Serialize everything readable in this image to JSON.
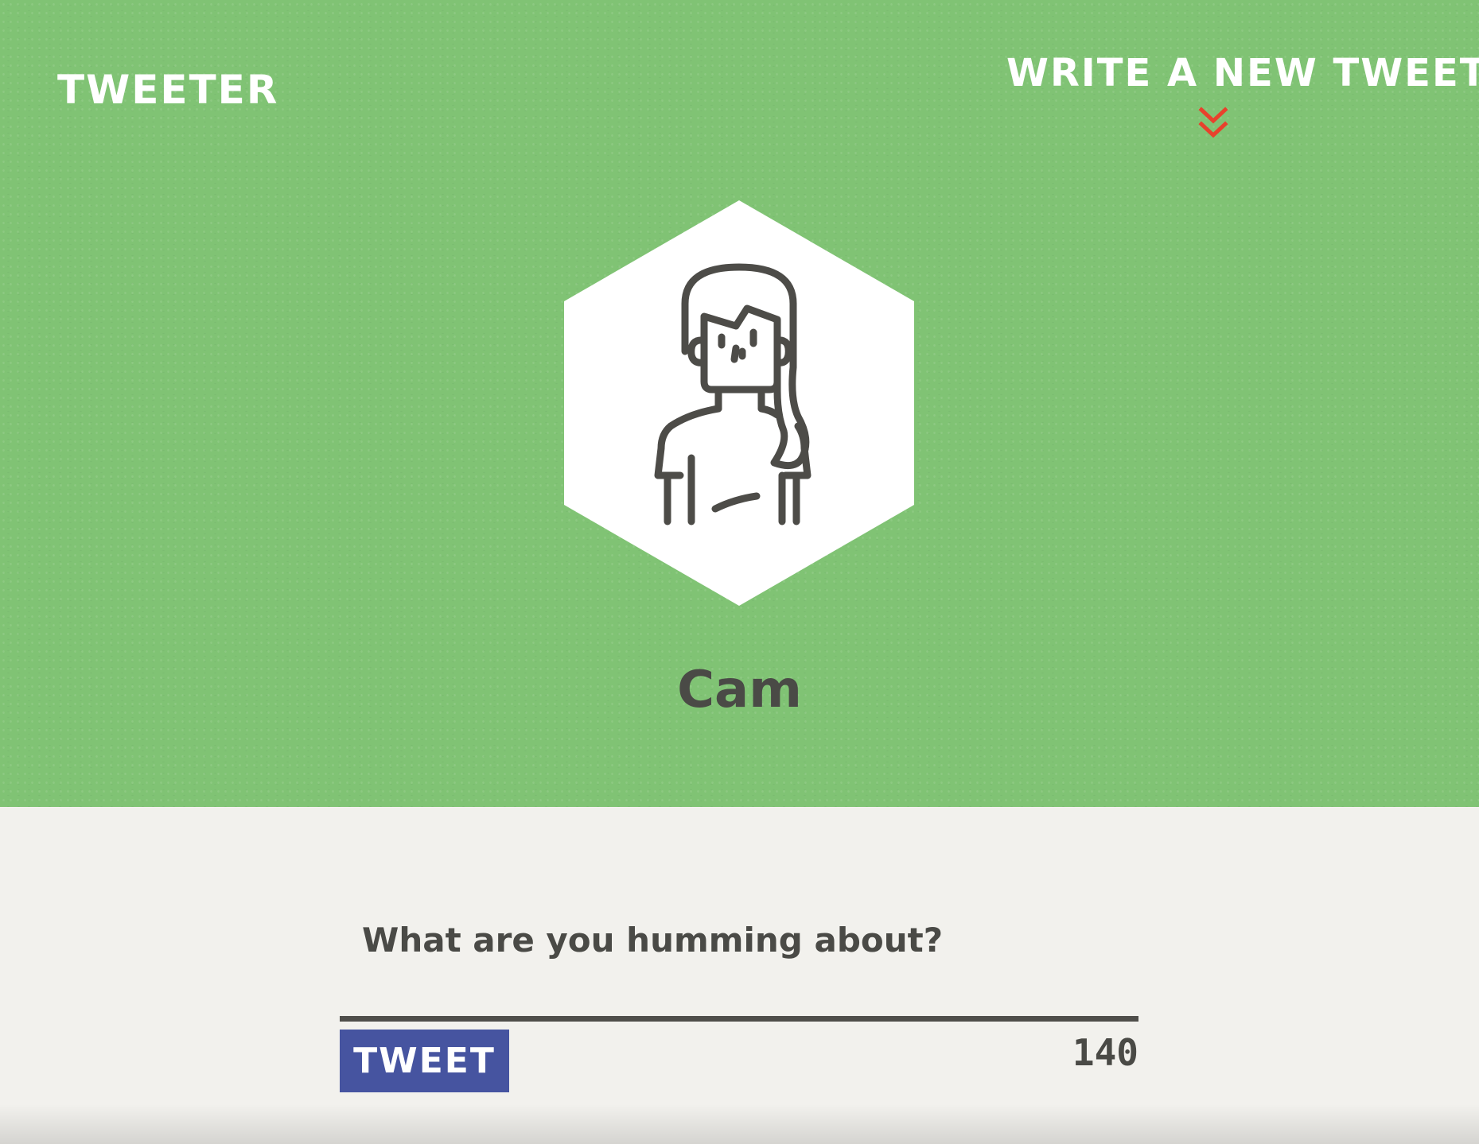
{
  "nav": {
    "logo": "Tweeter",
    "compose_link": "Write a new tweet",
    "compose_icon": "double-chevron-down-icon"
  },
  "profile": {
    "name": "Cam",
    "avatar_icon": "woman-avatar-icon"
  },
  "composer": {
    "placeholder": "What are you humming about?",
    "value": "",
    "submit_label": "Tweet",
    "char_counter": "140"
  },
  "colors": {
    "hero_background": "#80c374",
    "page_background": "#f2f1ed",
    "button_background": "#4654a0",
    "chevron": "#e8412c",
    "text_dark": "#4a4a46"
  }
}
